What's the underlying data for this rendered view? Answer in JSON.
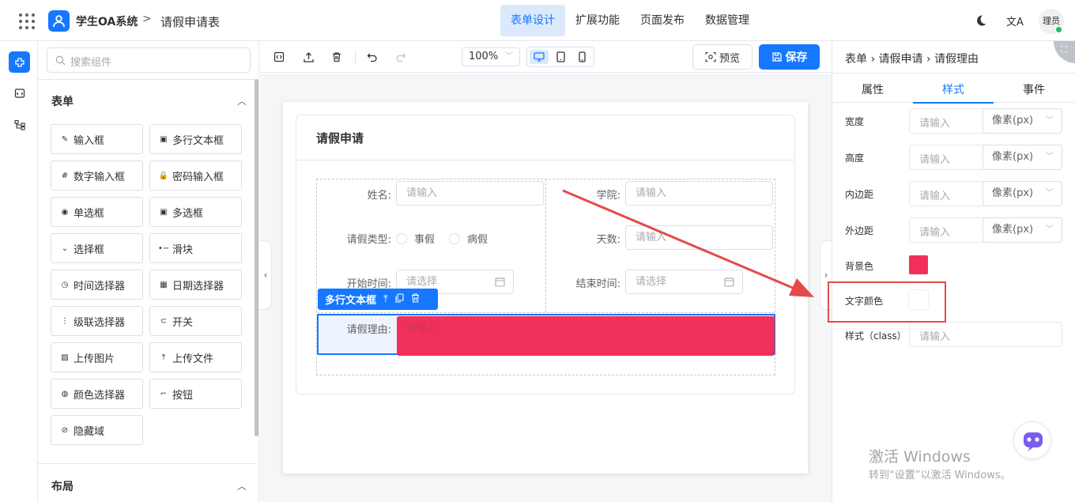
{
  "header": {
    "app_name": "学生OA系统",
    "crumb_sep": ">",
    "page_name": "请假申请表",
    "nav": [
      "表单设计",
      "扩展功能",
      "页面发布",
      "数据管理"
    ],
    "active_nav": "表单设计",
    "user_label": "理员",
    "translate_glyph": "文A"
  },
  "palette": {
    "search_placeholder": "搜索组件",
    "section_form": "表单",
    "section_layout": "布局",
    "components": [
      {
        "label": "输入框",
        "icon": "pencil-icon"
      },
      {
        "label": "多行文本框",
        "icon": "textarea-icon"
      },
      {
        "label": "数字输入框",
        "icon": "number-icon"
      },
      {
        "label": "密码输入框",
        "icon": "lock-icon"
      },
      {
        "label": "单选框",
        "icon": "radio-icon"
      },
      {
        "label": "多选框",
        "icon": "checkbox-icon"
      },
      {
        "label": "选择框",
        "icon": "select-icon"
      },
      {
        "label": "滑块",
        "icon": "slider-icon"
      },
      {
        "label": "时间选择器",
        "icon": "clock-icon"
      },
      {
        "label": "日期选择器",
        "icon": "calendar-icon"
      },
      {
        "label": "级联选择器",
        "icon": "cascader-icon"
      },
      {
        "label": "开关",
        "icon": "switch-icon"
      },
      {
        "label": "上传图片",
        "icon": "image-icon"
      },
      {
        "label": "上传文件",
        "icon": "upload-icon"
      },
      {
        "label": "颜色选择器",
        "icon": "palette-icon"
      },
      {
        "label": "按钮",
        "icon": "button-icon"
      },
      {
        "label": "隐藏域",
        "icon": "eye-off-icon"
      }
    ]
  },
  "toolbar": {
    "zoom": "100%",
    "preview_label": "预览",
    "save_label": "保存"
  },
  "form": {
    "title": "请假申请",
    "fields": {
      "name_label": "姓名:",
      "name_placeholder": "请输入",
      "college_label": "学院:",
      "college_placeholder": "请输入",
      "type_label": "请假类型:",
      "type_options": [
        "事假",
        "病假"
      ],
      "days_label": "天数:",
      "days_placeholder": "请输入",
      "start_label": "开始时间:",
      "start_placeholder": "请选择",
      "end_label": "结束时间:",
      "end_placeholder": "请选择",
      "reason_label": "请假理由:",
      "reason_placeholder": "请输入"
    },
    "selected_component": "多行文本框",
    "selected_bg_color": "#f0305a"
  },
  "props_panel": {
    "crumb": [
      "表单",
      "请假申请",
      "请假理由"
    ],
    "tabs": [
      "属性",
      "样式",
      "事件"
    ],
    "active_tab": "样式",
    "rows": [
      {
        "label": "宽度",
        "placeholder": "请输入",
        "unit": "像素(px)"
      },
      {
        "label": "高度",
        "placeholder": "请输入",
        "unit": "像素(px)"
      },
      {
        "label": "内边距",
        "placeholder": "请输入",
        "unit": "像素(px)"
      },
      {
        "label": "外边距",
        "placeholder": "请输入",
        "unit": "像素(px)"
      }
    ],
    "bg_color_label": "背景色",
    "bg_color_value": "#f0305a",
    "text_color_label": "文字颜色",
    "class_label": "样式（class）",
    "class_placeholder": "请输入"
  },
  "watermark": {
    "line1": "激活 Windows",
    "line2": "转到“设置”以激活 Windows。"
  },
  "colors": {
    "accent": "#1677ff",
    "annotation_red": "#e54a4a"
  }
}
